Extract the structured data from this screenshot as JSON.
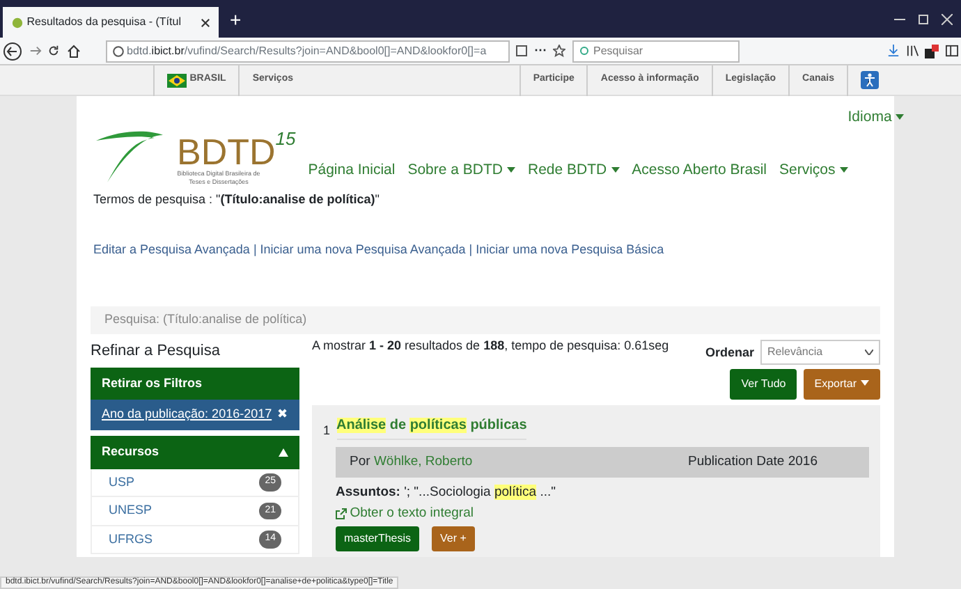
{
  "browser": {
    "tab_title": "Resultados da pesquisa - (Títul",
    "new_tab": "+",
    "url_prefix": "bdtd.",
    "url_domain": "ibict.br",
    "url_rest": "/vufind/Search/Results?join=AND&bool0[]=AND&lookfor0[]=a",
    "more": "···",
    "search_placeholder": "Pesquisar",
    "status_url": "bdtd.ibict.br/vufind/Search/Results?join=AND&bool0[]=AND&lookfor0[]=analise+de+politica&type0[]=Title"
  },
  "gov_bar": {
    "country": "BRASIL",
    "services": "Serviços",
    "links": [
      "Participe",
      "Acesso à informação",
      "Legislação",
      "Canais"
    ]
  },
  "header": {
    "logo_text": "BDTD",
    "logo_years": "15",
    "logo_sub": "Biblioteca Digital Brasileira de Teses e Dissertações",
    "language": "Idioma",
    "nav": [
      {
        "label": "Página Inicial",
        "dropdown": false
      },
      {
        "label": "Sobre a BDTD",
        "dropdown": true
      },
      {
        "label": "Rede BDTD",
        "dropdown": true
      },
      {
        "label": "Acesso Aberto Brasil",
        "dropdown": false
      },
      {
        "label": "Serviços",
        "dropdown": true
      }
    ]
  },
  "search_terms": "Termos de pesquisa : \"**(Título:analise de política)**\"",
  "search_link_separator": "|",
  "search_links": [
    "Editar a Pesquisa Avançada",
    "Iniciar uma nova Pesquisa Avançada",
    "Iniciar uma nova Pesquisa Básica"
  ],
  "breadcrumb": "Pesquisa: (Título:analise de política)",
  "sidebar": {
    "title": "Refinar a Pesquisa",
    "remove_filters": "Retirar os Filtros",
    "filters": [
      {
        "label": "Ano da publicação: 2016-2017",
        "remove": "✖"
      }
    ],
    "facet": {
      "title": "Recursos",
      "expanded": true,
      "items": [
        {
          "label": "USP",
          "count": "25"
        },
        {
          "label": "UNESP",
          "count": "21"
        },
        {
          "label": "UFRGS",
          "count": "14"
        }
      ]
    }
  },
  "results": {
    "summary": "A mostrar **1 - 20** resultados de **188**, tempo de pesquisa: 0.61seg",
    "sort_label": "Ordenar",
    "sort_value": "Relevância",
    "view_all": "Ver Tudo",
    "export": "Exportar",
    "items": [
      {
        "number": "1",
        "title": [
          {
            "text": "Análise",
            "highlight": true
          },
          {
            "text": "de",
            "highlight": false
          },
          {
            "text": "políticas",
            "highlight": true
          },
          {
            "text": "públicas",
            "highlight": false
          }
        ],
        "author_label": "Por",
        "author": "Wöhlke, Roberto",
        "date": "Publication Date 2016",
        "subjects_label": "Assuntos:",
        "subjects": [
          {
            "text": "'; \"...Sociologia",
            "highlight": false
          },
          {
            "text": "política",
            "highlight": true
          },
          {
            "text": "...\"",
            "highlight": false
          }
        ],
        "fulltext": "Obter o texto integral",
        "type_badge": "masterThesis",
        "more": "Ver +"
      }
    ]
  }
}
